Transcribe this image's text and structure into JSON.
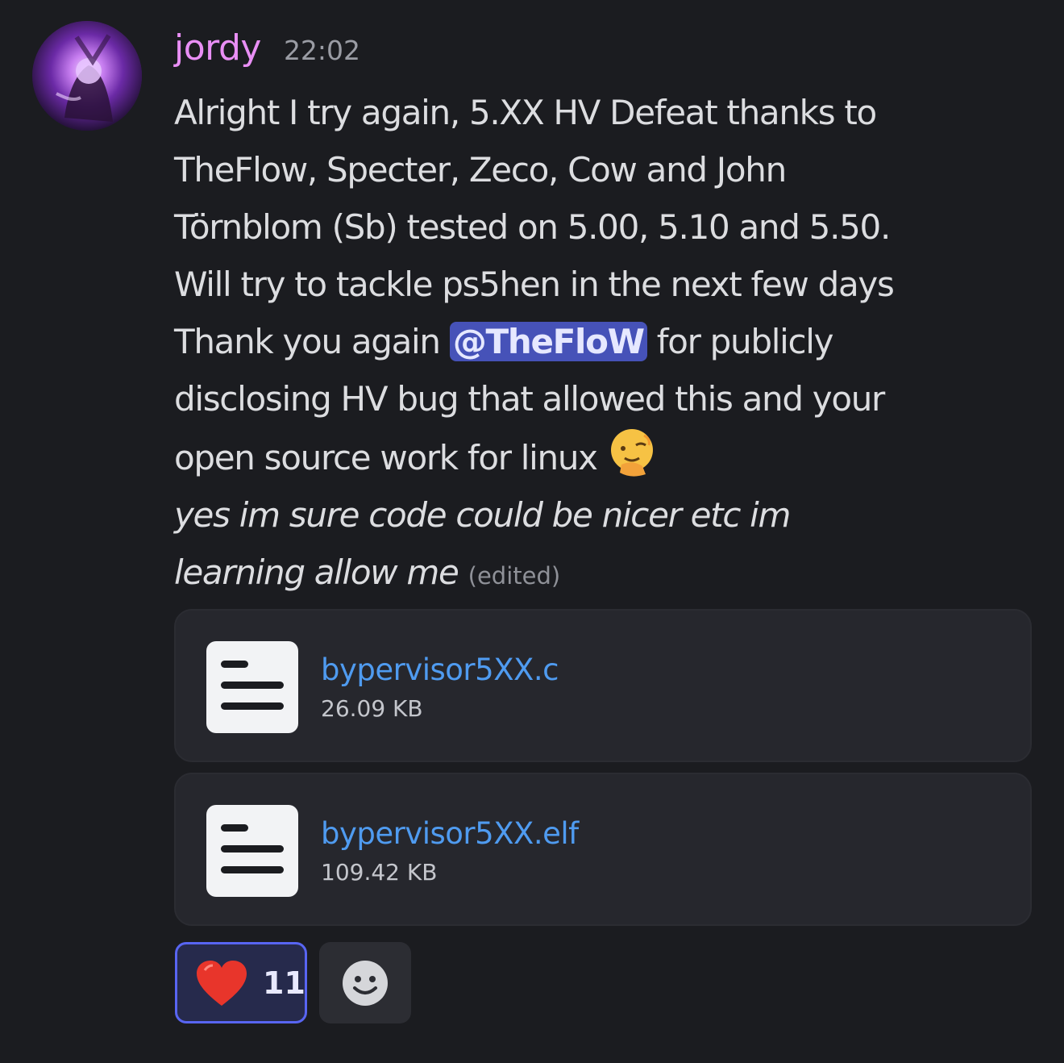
{
  "message": {
    "author": "jordy",
    "timestamp": "22:02",
    "lines": [
      "Alright I try again, 5.XX HV Defeat thanks to",
      "TheFlow, Specter, Zeco, Cow and John",
      "Törnblom (Sb)  tested on 5.00, 5.10 and 5.50.",
      "Will try to tackle ps5hen in the next few days"
    ],
    "thanks_prefix": "Thank you again ",
    "mention": "@TheFloW",
    "thanks_suffix": " for publicly",
    "line_disclosing": "disclosing HV bug that allowed this and your",
    "line_open_source": "open source work for linux",
    "emoji": "shushing-face-emoji",
    "italic_lines": [
      "yes im sure code could be nicer etc im",
      "learning allow me"
    ],
    "edited_label": "(edited)"
  },
  "attachments": [
    {
      "name": "bypervisor5XX.c",
      "size": "26.09 KB",
      "icon": "file-icon"
    },
    {
      "name": "bypervisor5XX.elf",
      "size": "109.42 KB",
      "icon": "file-icon"
    }
  ],
  "reactions": [
    {
      "emoji": "red-heart-emoji",
      "count": "11",
      "active": true
    }
  ],
  "add_reaction": {
    "icon": "add-reaction-smiley-icon"
  },
  "colors": {
    "background": "#1b1c20",
    "username": "#e98ff5",
    "link": "#4f9bf0",
    "mention_bg": "#4652b8",
    "reaction_border": "#5865f2"
  }
}
